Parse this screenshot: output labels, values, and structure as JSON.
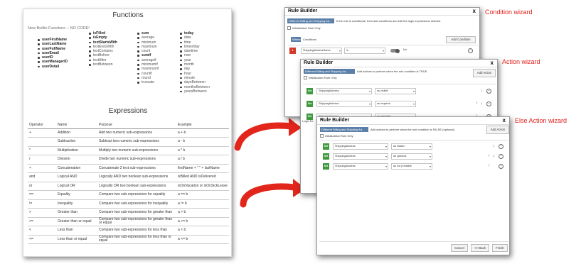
{
  "functions": {
    "title": "Functions",
    "subtitle": "New Builtin Functions -- NO CODE!",
    "col1": [
      "userFirstName",
      "userLastName",
      "userFullName",
      "userEmail",
      "userID",
      "userManagerID",
      "userDetail"
    ],
    "col2": [
      "isFilled",
      "isEmpty",
      "textStartsWith",
      "textEndsWith",
      "textContains",
      "textBefore",
      "textAfter",
      "textBetween"
    ],
    "col3": [
      "sum",
      "average",
      "minimum",
      "maximum",
      "count",
      "sumif",
      "averageif",
      "minimumif",
      "maximumif",
      "countif",
      "round",
      "truncate"
    ],
    "col4": [
      "today",
      "date",
      "time",
      "timeofday",
      "datetime",
      "now",
      "year",
      "month",
      "day",
      "hour",
      "minute",
      "daysBetween",
      "monthsBetween",
      "yearsBetween"
    ]
  },
  "expressions": {
    "title": "Expressions",
    "headers": [
      "Operator",
      "Name",
      "Purpose",
      "Example"
    ],
    "rows": [
      [
        "+",
        "Addition",
        "Add two numeric sub-expressions",
        "a + b"
      ],
      [
        "",
        "Subtraction",
        "Subtract two numeric sub-expressions",
        "a - b"
      ],
      [
        "*",
        "Multiplication",
        "Multiply two numeric sub-expressions",
        "a * b"
      ],
      [
        "/",
        "Division",
        "Divide two numeric sub-expressions",
        "a / b"
      ],
      [
        "+",
        "Concatenation",
        "Concatenate 2 text sub-expressions",
        "firstName + \" \" + lastName"
      ],
      [
        "and",
        "Logical AND",
        "Logically AND two boolean sub-expressions",
        "isBilled AND isDelivered"
      ],
      [
        "or",
        "Logical OR",
        "Logically OR two boolean sub-expressions",
        "isOnVacation or isOnSickLeave"
      ],
      [
        "==",
        "Equality",
        "Compare two sub-expressions for equality",
        "a == b"
      ],
      [
        "!=",
        "Inequality",
        "Compare two sub-expressions for inequality",
        "a != b"
      ],
      [
        ">",
        "Greater than",
        "Compare two sub-expressions for greater than",
        "a > b"
      ],
      [
        ">=",
        "Greater than or equal",
        "Compare two sub-expressions for greater than or equal",
        "a >= b"
      ],
      [
        "<",
        "Less than",
        "Compare two sub-expressions for less than",
        "a < b"
      ],
      [
        "<=",
        "Less than or equal",
        "Compare two sub-expressions for less than or equal",
        "a <= b"
      ]
    ]
  },
  "labels": {
    "condition": "Condition wizard",
    "action": "Action wizard",
    "else_action": "Else Action wizard"
  },
  "condition_modal": {
    "title": "Rule Builder",
    "close": "x",
    "pill": "Different Billing and Shipping Ad...",
    "description": "If the rule is conditional, then add conditions and edit the logic expressions needed.",
    "checkbox": "Initialization Rule Only",
    "where_badge": "Where",
    "conditions_tab": "Conditions",
    "add_button": "Add Condition",
    "row": {
      "num": "1",
      "field": "ShippingAddressSame",
      "operator": "is",
      "value": "No"
    }
  },
  "action_modal": {
    "title": "Rule Builder",
    "close": "x",
    "pill": "Different Billing and Shipping Ad...",
    "description": "Add actions to perform when the rule condition is TRUE.",
    "checkbox": "Initialization Rule Only",
    "add_button": "Add Action",
    "side_text": "Logic Ex",
    "rows": [
      {
        "tag": "Set",
        "field": "ShippingAddress",
        "value": "as visible"
      },
      {
        "tag": "Set",
        "field": "ShippingAddress",
        "value": "as required"
      },
      {
        "tag": "Set",
        "field": "ShippingAddress",
        "value": "as printable"
      }
    ]
  },
  "else_modal": {
    "title": "Rule Builder",
    "close": "x",
    "pill": "Different Billing and Shipping Ad...",
    "description": "Add actions to perform when the rule condition is FALSE (optional).",
    "checkbox": "Initialization Rule Only",
    "add_button": "Add Action",
    "rows": [
      {
        "tag": "Set",
        "field": "ShippingAddress",
        "value": "as hidden"
      },
      {
        "tag": "Set",
        "field": "ShippingAddress",
        "value": "as optional"
      },
      {
        "tag": "Set",
        "field": "ShippingAddress",
        "value": "as not printable"
      }
    ],
    "cancel": "Cancel",
    "back": "<< Back",
    "finish": "Finish"
  },
  "colors": {
    "tag_green": "#3f9a3f",
    "tag_red": "#d43a2a",
    "pill_blue": "#5a7fa8",
    "arrow_red": "#e2261b",
    "label_red": "#e0201b"
  },
  "icons": {
    "down": "arrow-down-icon",
    "up": "arrow-up-icon",
    "remove": "minus-circle-icon",
    "toggle": "toggle-switch-icon"
  }
}
